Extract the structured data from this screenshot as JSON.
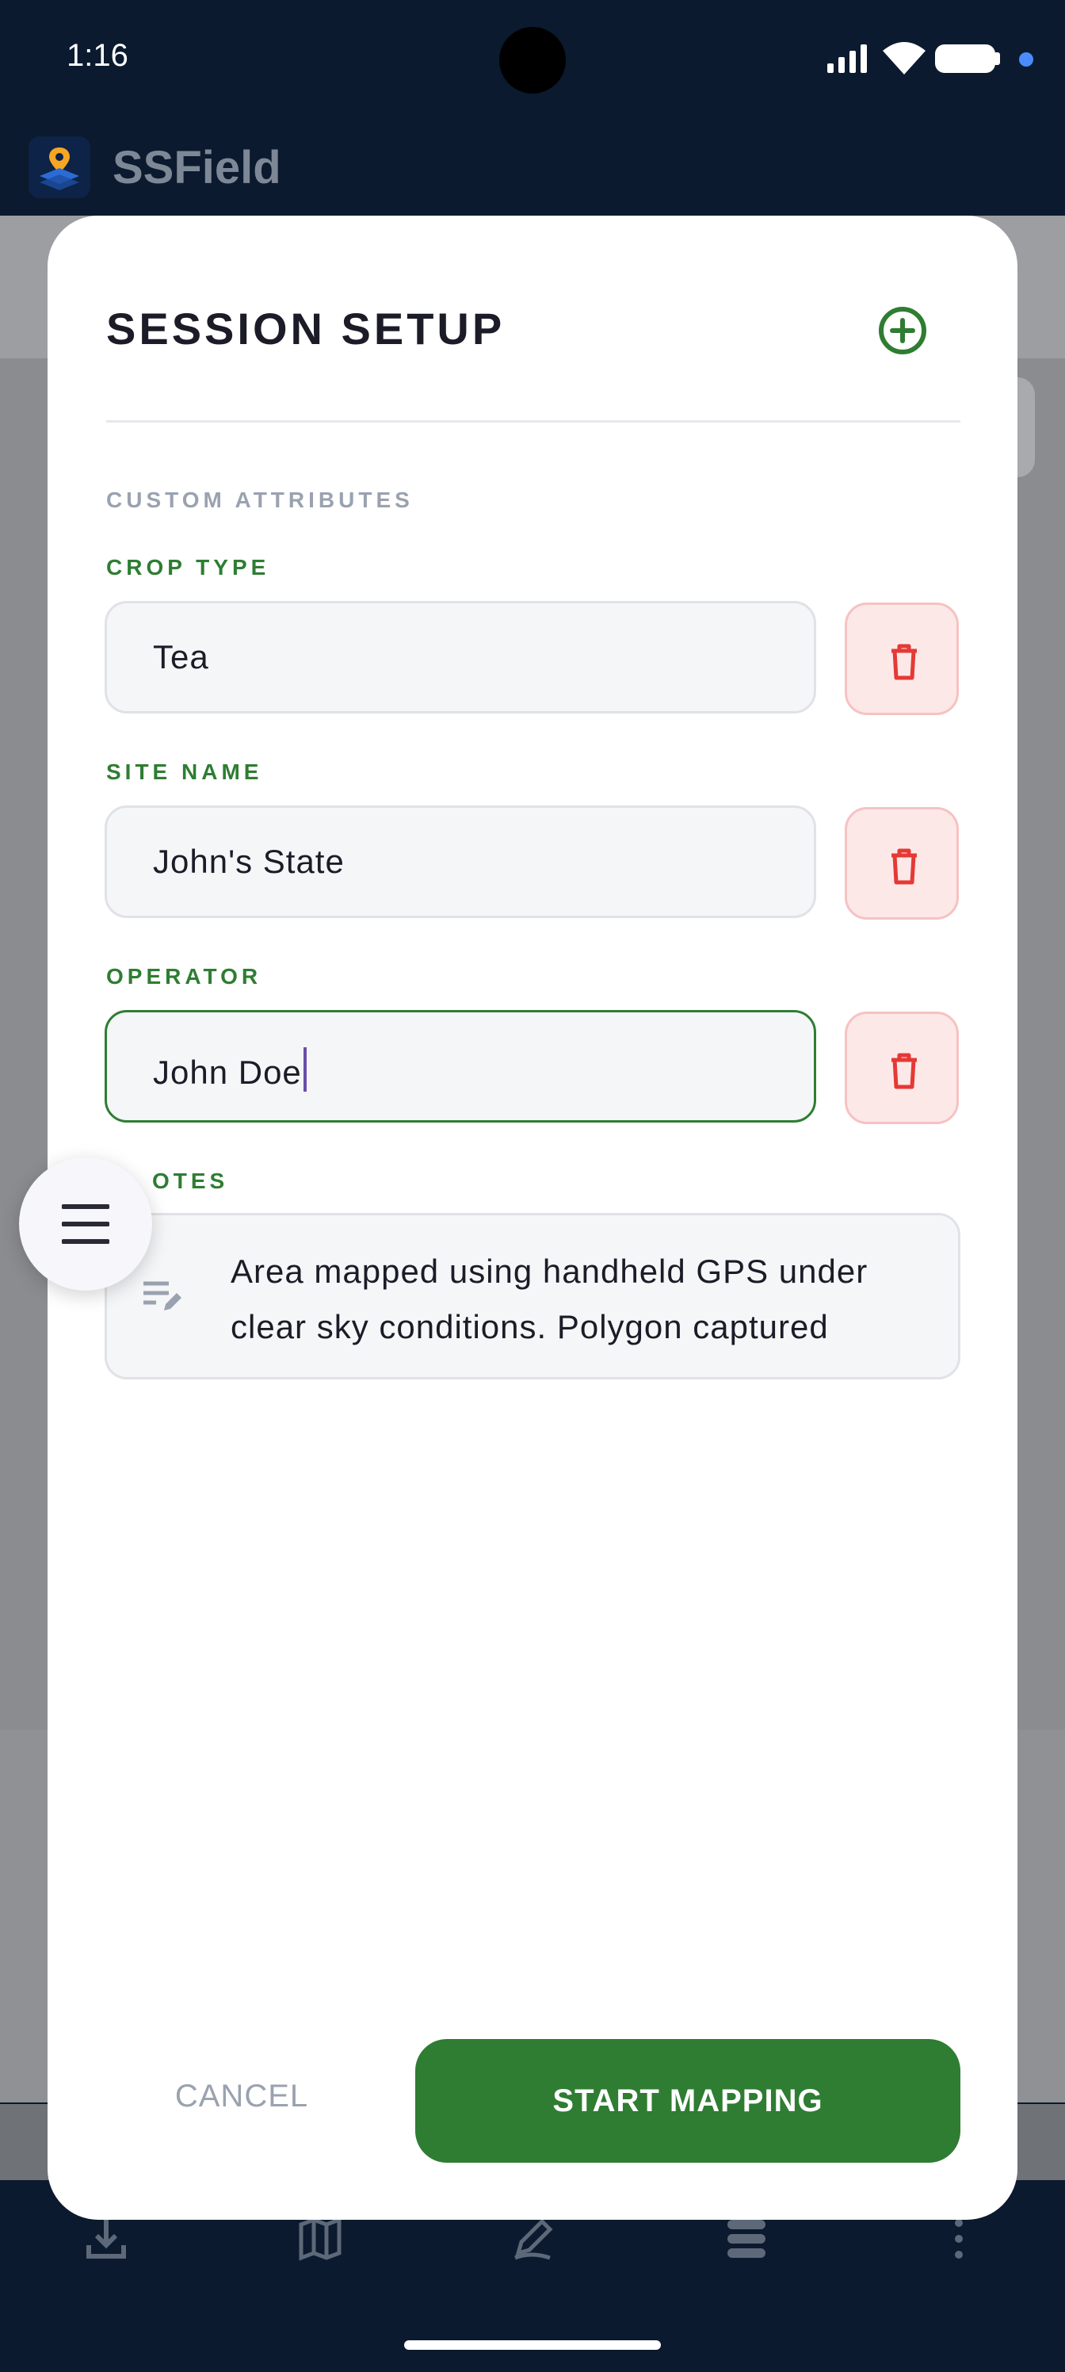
{
  "status_bar": {
    "time": "1:16"
  },
  "app_bar": {
    "title": "SSField"
  },
  "dialog": {
    "title": "SESSION SETUP",
    "section_label": "CUSTOM ATTRIBUTES",
    "fields": [
      {
        "label": "CROP TYPE",
        "value": "Tea"
      },
      {
        "label": "SITE NAME",
        "value": "John's State"
      },
      {
        "label": "OPERATOR",
        "value": "John Doe"
      }
    ],
    "notes": {
      "label": "OTES",
      "value": "Area mapped using handheld GPS under clear sky conditions. Polygon captured"
    },
    "cancel_label": "CANCEL",
    "start_label": "START MAPPING"
  },
  "colors": {
    "accent_green": "#2e7d32",
    "delete_red": "#e53935",
    "dark_navy": "#0b1a2e"
  },
  "icons": {
    "add": "plus-circle-icon",
    "delete": "trash-icon",
    "notes": "notes-edit-icon",
    "menu": "hamburger-menu-icon"
  }
}
